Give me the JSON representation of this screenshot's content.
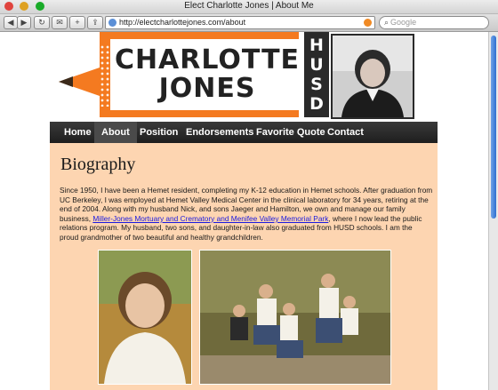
{
  "window": {
    "title": "Elect Charlotte Jones | About Me"
  },
  "toolbar": {
    "url": "http://electcharlottejones.com/about",
    "search_placeholder": "Google"
  },
  "header": {
    "name_line1": "CHARLOTTE",
    "name_line2": "JONES",
    "district": "HUSD"
  },
  "nav": {
    "items": [
      {
        "label": "Home"
      },
      {
        "label": "About"
      },
      {
        "label": "Position"
      },
      {
        "label": "Endorsements"
      },
      {
        "label": "Favorite Quote"
      },
      {
        "label": "Contact"
      }
    ],
    "active": "About"
  },
  "main": {
    "heading": "Biography",
    "bio_part1": "Since 1950, I have been a Hemet resident, completing my K-12 education in Hemet schools. After graduation from UC Berkeley, I was employed at Hemet Valley Medical Center in the clinical laboratory for 34 years, retiring at the end of 2004. Along with my husband Nick, and sons Jaeger and Hamilton, we own and manage our family business, ",
    "bio_link": "Miller-Jones Mortuary and Crematory and Menifee Valley Memorial Park",
    "bio_part2": ", where I now lead the public relations program. My husband, two sons, and daughter-in-law also graduated from HUSD schools. I am the proud grandmother of two beautiful and healthy grandchildren."
  },
  "colors": {
    "brand_orange": "#f47a20",
    "content_bg": "#fdd5b1",
    "nav_bg": "#2a2a2a",
    "link": "#1a1ae0"
  }
}
